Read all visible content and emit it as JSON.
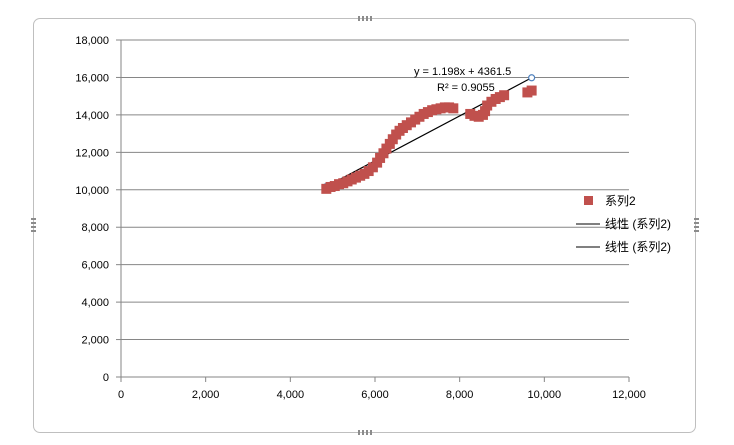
{
  "chart_data": {
    "type": "scatter",
    "title": "",
    "xlabel": "",
    "ylabel": "",
    "xlim": [
      0,
      12000
    ],
    "ylim": [
      0,
      18000
    ],
    "xticks": [
      0,
      2000,
      4000,
      6000,
      8000,
      10000,
      12000
    ],
    "yticks": [
      0,
      2000,
      4000,
      6000,
      8000,
      10000,
      12000,
      14000,
      16000,
      18000
    ],
    "xtick_labels": [
      "0",
      "2,000",
      "4,000",
      "6,000",
      "8,000",
      "10,000",
      "12,000"
    ],
    "ytick_labels": [
      "0",
      "2,000",
      "4,000",
      "6,000",
      "8,000",
      "10,000",
      "12,000",
      "14,000",
      "16,000",
      "18,000"
    ],
    "grid": "horizontal",
    "legend_position": "right",
    "series": [
      {
        "name": "系列2",
        "marker": "square",
        "color": "#c0504d",
        "x": [
          4850,
          4950,
          5050,
          5150,
          5250,
          5350,
          5450,
          5550,
          5650,
          5750,
          5850,
          5950,
          6050,
          6120,
          6200,
          6270,
          6350,
          6420,
          6500,
          6580,
          6660,
          6750,
          6850,
          6950,
          7050,
          7150,
          7250,
          7350,
          7450,
          7550,
          7650,
          7750,
          7850,
          8250,
          8350,
          8450,
          8550,
          8600,
          8650,
          8750,
          8850,
          8950,
          9050,
          9600,
          9700
        ],
        "y": [
          10050,
          10150,
          10200,
          10300,
          10350,
          10450,
          10550,
          10650,
          10750,
          10850,
          11000,
          11200,
          11450,
          11700,
          11950,
          12200,
          12450,
          12700,
          12950,
          13150,
          13300,
          13450,
          13600,
          13750,
          13900,
          14050,
          14150,
          14250,
          14300,
          14350,
          14400,
          14400,
          14350,
          14050,
          13950,
          13900,
          14000,
          14200,
          14500,
          14700,
          14850,
          14950,
          15050,
          15200,
          15300
        ]
      }
    ],
    "trendline": {
      "legend_label": "线性 (系列2)",
      "equation": "y = 1.198x + 4361.5",
      "r_squared": "R² = 0.9055",
      "slope": 1.198,
      "intercept": 4361.5,
      "x_start": 4850,
      "x_end": 9700,
      "color": "#000000",
      "endpoint_color": "#4f81bd"
    },
    "legend": [
      "系列2",
      "线性 (系列2)",
      "线性 (系列2)"
    ]
  }
}
